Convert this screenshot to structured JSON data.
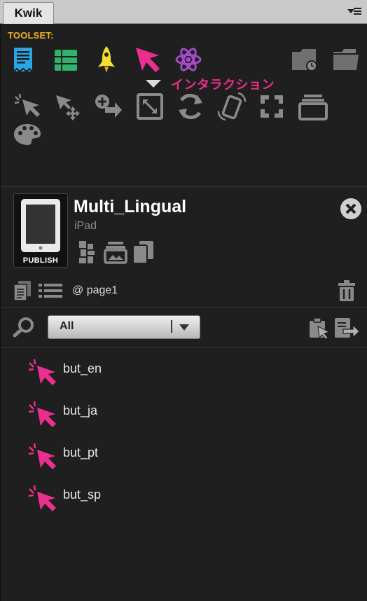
{
  "panel": {
    "tab_title": "Kwik"
  },
  "toolset": {
    "label": "TOOLSET:",
    "active_hint": "インタラクション"
  },
  "project": {
    "name": "Multi_Lingual",
    "device": "iPad",
    "publish_label": "PUBLISH"
  },
  "page": {
    "name": "@ page1"
  },
  "filter": {
    "selected": "All"
  },
  "layers": [
    {
      "name": "but_en"
    },
    {
      "name": "but_ja"
    },
    {
      "name": "but_pt"
    },
    {
      "name": "but_sp"
    }
  ],
  "colors": {
    "accent_pink": "#ec2f8f",
    "toolset_label": "#f2b21c"
  }
}
